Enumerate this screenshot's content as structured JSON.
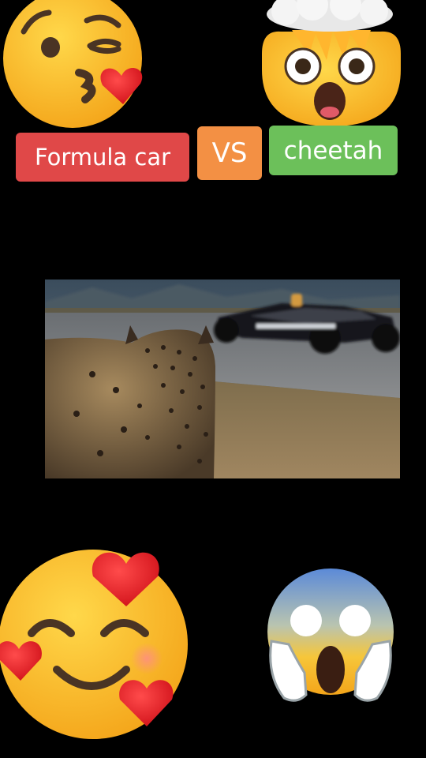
{
  "labels": {
    "left": "Formula car",
    "middle": "VS",
    "right": "cheetah"
  },
  "colors": {
    "background": "#000000",
    "left_tag": "#e04848",
    "middle_tag": "#f39044",
    "right_tag": "#6cc05a"
  },
  "emojis": {
    "top_left": "kissing-wink-heart-emoji",
    "top_right": "exploding-head-emoji",
    "bottom_left": "smiling-face-with-hearts-emoji",
    "bottom_right": "screaming-in-fear-emoji"
  },
  "video": {
    "scene": "cheetah-watching-formula-car-frame"
  }
}
